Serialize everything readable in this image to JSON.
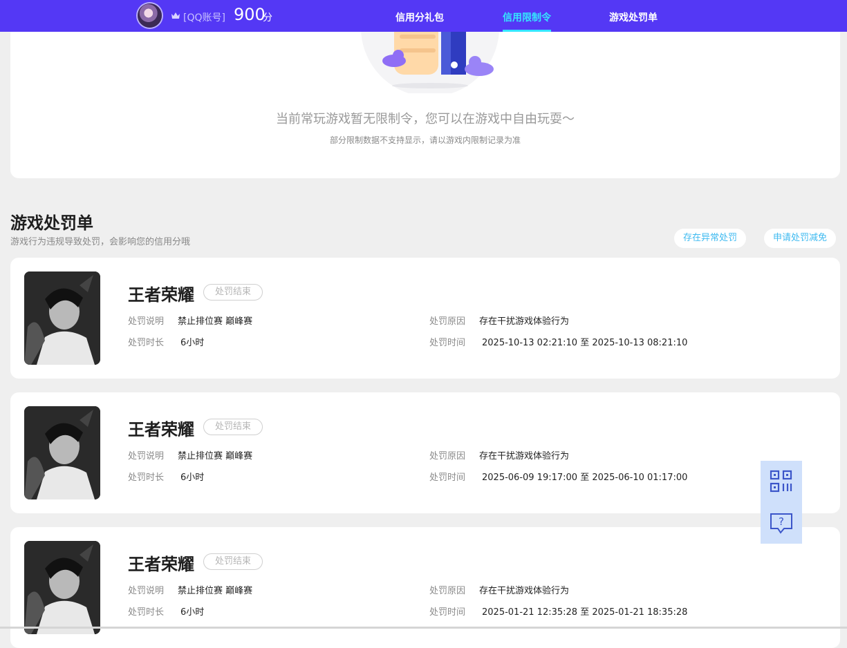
{
  "header": {
    "account_label": "[QQ账号]",
    "score": "900",
    "score_unit": "分",
    "tabs": [
      {
        "label": "信用分礼包",
        "active": false
      },
      {
        "label": "信用限制令",
        "active": true
      },
      {
        "label": "游戏处罚单",
        "active": false
      }
    ]
  },
  "restriction": {
    "empty_message": "当前常玩游戏暂无限制令，您可以在游戏中自由玩耍～",
    "note": "部分限制数据不支持显示，请以游戏内限制记录为准"
  },
  "penalty_section": {
    "title": "游戏处罚单",
    "subtitle": "游戏行为违规导致处罚，会影响您的信用分哦",
    "buttons": [
      "存在异常处罚",
      "申请处罚减免"
    ]
  },
  "penalties": [
    {
      "game": "王者荣耀",
      "status": "处罚结束",
      "desc_label": "处罚说明",
      "desc_value": "禁止排位赛 巅峰赛",
      "reason_label": "处罚原因",
      "reason_value": "存在干扰游戏体验行为",
      "duration_label": "处罚时长",
      "duration_value": "6小时",
      "time_label": "处罚时间",
      "time_value": "2025-10-13 02:21:10 至 2025-10-13 08:21:10"
    },
    {
      "game": "王者荣耀",
      "status": "处罚结束",
      "desc_label": "处罚说明",
      "desc_value": "禁止排位赛 巅峰赛",
      "reason_label": "处罚原因",
      "reason_value": "存在干扰游戏体验行为",
      "duration_label": "处罚时长",
      "duration_value": "6小时",
      "time_label": "处罚时间",
      "time_value": "2025-06-09 19:17:00 至 2025-06-10 01:17:00"
    },
    {
      "game": "王者荣耀",
      "status": "处罚结束",
      "desc_label": "处罚说明",
      "desc_value": "禁止排位赛 巅峰赛",
      "reason_label": "处罚原因",
      "reason_value": "存在干扰游戏体验行为",
      "duration_label": "处罚时长",
      "duration_value": "6小时",
      "time_label": "处罚时间",
      "time_value": "2025-01-21 12:35:28 至 2025-01-21 18:35:28"
    }
  ],
  "floating": {
    "icons": [
      "qr-code-icon",
      "help-chat-icon"
    ]
  },
  "colors": {
    "header_bg": "#5438f5",
    "active_tab": "#35e7ff",
    "pill_text": "#3ebaf0",
    "float_bg": "#cfe0fb"
  }
}
